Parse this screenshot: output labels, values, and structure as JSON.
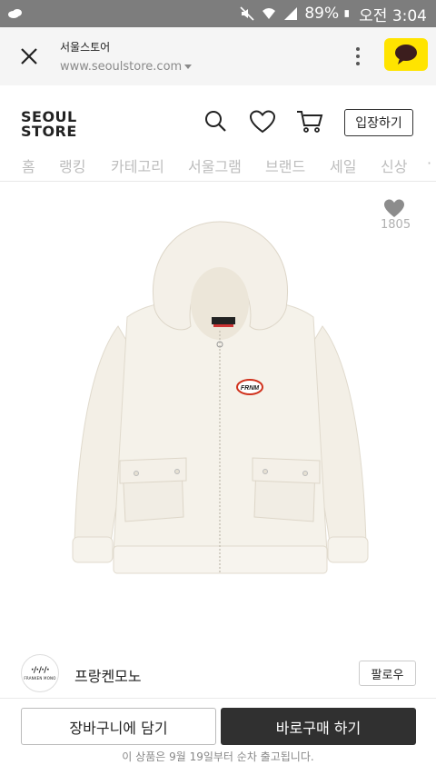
{
  "status_bar": {
    "battery": "89%",
    "time": "오전 3:04",
    "icons": [
      "notification-icon",
      "mute-icon",
      "wifi-icon",
      "signal-icon",
      "battery-icon"
    ]
  },
  "browser": {
    "site_name": "서울스토어",
    "url": "www.seoulstore.com",
    "close_icon": "close-icon",
    "menu_icon": "more-vert-icon",
    "talk_icon": "kakaotalk-icon",
    "talk_color": "#ffe400"
  },
  "header": {
    "logo_line1": "SEOUL",
    "logo_line2": "STORE",
    "enter_label": "입장하기",
    "icons": [
      "search-icon",
      "heart-icon",
      "cart-icon"
    ]
  },
  "nav": {
    "tabs": [
      "홈",
      "랭킹",
      "카테고리",
      "서울그램",
      "브랜드",
      "세일",
      "신상"
    ]
  },
  "product": {
    "like_count": "1805",
    "patch_text": "FRNM",
    "image_desc_icon": "hoodie-jacket-image"
  },
  "brand": {
    "name": "프랑켄모노",
    "logo_mark": "·/·/·/·",
    "logo_caption": "FRANKEN MONO",
    "follow_label": "팔로우"
  },
  "bottom": {
    "cart_label": "장바구니에 담기",
    "buy_label": "바로구매 하기",
    "ship_note": "이 상품은 9월 19일부터 순차 출고됩니다.",
    "buy_color": "#303030"
  }
}
